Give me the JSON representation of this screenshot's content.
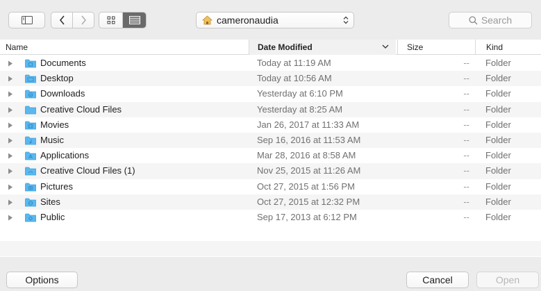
{
  "toolbar": {
    "location_label": "cameronaudia",
    "search_placeholder": "Search"
  },
  "columns": {
    "name": "Name",
    "date_modified": "Date Modified",
    "size": "Size",
    "kind": "Kind"
  },
  "files": [
    {
      "name": "Documents",
      "date": "Today at 11:19 AM",
      "size": "--",
      "kind": "Folder",
      "icon": "documents-folder-icon"
    },
    {
      "name": "Desktop",
      "date": "Today at 10:56 AM",
      "size": "--",
      "kind": "Folder",
      "icon": "desktop-folder-icon"
    },
    {
      "name": "Downloads",
      "date": "Yesterday at 6:10 PM",
      "size": "--",
      "kind": "Folder",
      "icon": "downloads-folder-icon"
    },
    {
      "name": "Creative Cloud Files",
      "date": "Yesterday at 8:25 AM",
      "size": "--",
      "kind": "Folder",
      "icon": "folder-icon"
    },
    {
      "name": "Movies",
      "date": "Jan 26, 2017 at 11:33 AM",
      "size": "--",
      "kind": "Folder",
      "icon": "movies-folder-icon"
    },
    {
      "name": "Music",
      "date": "Sep 16, 2016 at 11:53 AM",
      "size": "--",
      "kind": "Folder",
      "icon": "music-folder-icon"
    },
    {
      "name": "Applications",
      "date": "Mar 28, 2016 at 8:58 AM",
      "size": "--",
      "kind": "Folder",
      "icon": "applications-folder-icon"
    },
    {
      "name": "Creative Cloud Files (1)",
      "date": "Nov 25, 2015 at 11:26 AM",
      "size": "--",
      "kind": "Folder",
      "icon": "folder-icon"
    },
    {
      "name": "Pictures",
      "date": "Oct 27, 2015 at 1:56 PM",
      "size": "--",
      "kind": "Folder",
      "icon": "pictures-folder-icon"
    },
    {
      "name": "Sites",
      "date": "Oct 27, 2015 at 12:32 PM",
      "size": "--",
      "kind": "Folder",
      "icon": "sites-folder-icon"
    },
    {
      "name": "Public",
      "date": "Sep 17, 2013 at 6:12 PM",
      "size": "--",
      "kind": "Folder",
      "icon": "public-folder-icon"
    }
  ],
  "buttons": {
    "options": "Options",
    "cancel": "Cancel",
    "open": "Open"
  },
  "colors": {
    "folder_blue": "#5bb8ee",
    "folder_blue_dark": "#3aa0dc"
  }
}
